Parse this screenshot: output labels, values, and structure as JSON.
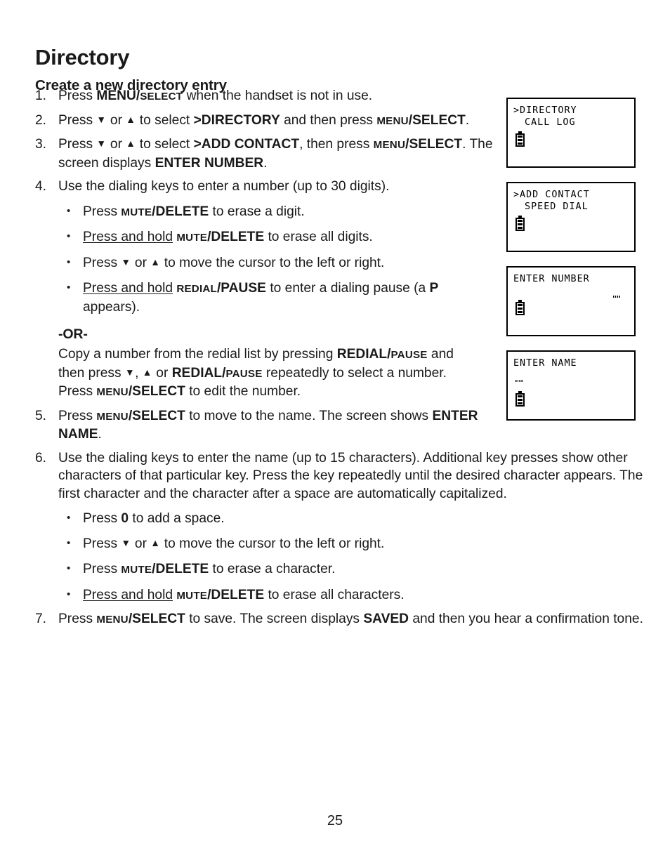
{
  "document": {
    "page_title": "Directory",
    "section_title": "Create a new directory entry",
    "page_number": "25"
  },
  "steps": [
    {
      "number": "1.",
      "parts": [
        {
          "t": "Press ",
          "s": "n"
        },
        {
          "t": "MENU",
          "s": "b"
        },
        {
          "t": "/",
          "s": "b"
        },
        {
          "t": "SELECT",
          "s": "sc"
        },
        {
          "t": " when the handset is not in use.",
          "s": "n"
        }
      ]
    },
    {
      "number": "2.",
      "parts": [
        {
          "t": "Press ",
          "s": "n"
        },
        {
          "t": "▼",
          "s": "ar"
        },
        {
          "t": " or ",
          "s": "n"
        },
        {
          "t": "▲",
          "s": "ar"
        },
        {
          "t": " to select ",
          "s": "n"
        },
        {
          "t": ">DIRECTORY",
          "s": "b"
        },
        {
          "t": " and then press ",
          "s": "n"
        },
        {
          "t": "MENU",
          "s": "sc"
        },
        {
          "t": "/SELECT",
          "s": "b"
        },
        {
          "t": ".",
          "s": "n"
        }
      ]
    },
    {
      "number": "3.",
      "parts": [
        {
          "t": "Press ",
          "s": "n"
        },
        {
          "t": "▼",
          "s": "ar"
        },
        {
          "t": " or ",
          "s": "n"
        },
        {
          "t": "▲",
          "s": "ar"
        },
        {
          "t": " to select ",
          "s": "n"
        },
        {
          "t": ">ADD CONTACT",
          "s": "b"
        },
        {
          "t": ", then press ",
          "s": "n"
        },
        {
          "t": "MENU",
          "s": "sc"
        },
        {
          "t": "/SELECT",
          "s": "b"
        },
        {
          "t": ". The screen displays ",
          "s": "n"
        },
        {
          "t": "ENTER NUMBER",
          "s": "b"
        },
        {
          "t": ".",
          "s": "n"
        }
      ]
    },
    {
      "number": "4.",
      "parts": [
        {
          "t": "Use the dialing keys to enter a number (up to 30 digits).",
          "s": "n"
        }
      ],
      "bullets": [
        [
          {
            "t": "Press ",
            "s": "n"
          },
          {
            "t": "MUTE",
            "s": "sc"
          },
          {
            "t": "/DELETE",
            "s": "b"
          },
          {
            "t": " to erase a digit.",
            "s": "n"
          }
        ],
        [
          {
            "t": "Press and hold",
            "s": "u"
          },
          {
            "t": " ",
            "s": "n"
          },
          {
            "t": "MUTE",
            "s": "sc"
          },
          {
            "t": "/DELETE",
            "s": "b"
          },
          {
            "t": " to erase all digits.",
            "s": "n"
          }
        ],
        [
          {
            "t": "Press ",
            "s": "n"
          },
          {
            "t": "▼",
            "s": "ar"
          },
          {
            "t": " or ",
            "s": "n"
          },
          {
            "t": "▲",
            "s": "ar"
          },
          {
            "t": " to move the cursor to the left or right.",
            "s": "n"
          }
        ],
        [
          {
            "t": "Press and hold",
            "s": "u"
          },
          {
            "t": " ",
            "s": "n"
          },
          {
            "t": "REDIAL",
            "s": "sc"
          },
          {
            "t": "/PAUSE",
            "s": "b"
          },
          {
            "t": " to enter a dialing pause (a ",
            "s": "n"
          },
          {
            "t": "P",
            "s": "b"
          },
          {
            "t": " appears).",
            "s": "n"
          }
        ]
      ],
      "or": {
        "label": "-OR-",
        "parts": [
          {
            "t": "Copy a number from the redial list by pressing ",
            "s": "n"
          },
          {
            "t": "REDIAL",
            "s": "b"
          },
          {
            "t": "/",
            "s": "b"
          },
          {
            "t": "PAUSE",
            "s": "sc"
          },
          {
            "t": " and then press ",
            "s": "n"
          },
          {
            "t": "▼",
            "s": "ar"
          },
          {
            "t": ", ",
            "s": "n"
          },
          {
            "t": "▲",
            "s": "ar"
          },
          {
            "t": " or ",
            "s": "n"
          },
          {
            "t": "REDIAL",
            "s": "b"
          },
          {
            "t": "/",
            "s": "b"
          },
          {
            "t": "PAUSE",
            "s": "sc"
          },
          {
            "t": " repeatedly to select a number. Press ",
            "s": "n"
          },
          {
            "t": "MENU",
            "s": "sc"
          },
          {
            "t": "/SELECT",
            "s": "b"
          },
          {
            "t": " to edit the number.",
            "s": "n"
          }
        ]
      }
    },
    {
      "number": "5.",
      "parts": [
        {
          "t": "Press ",
          "s": "n"
        },
        {
          "t": "MENU",
          "s": "sc"
        },
        {
          "t": "/SELECT",
          "s": "b"
        },
        {
          "t": " to move to the name. The screen shows ",
          "s": "n"
        },
        {
          "t": "ENTER NAME",
          "s": "b"
        },
        {
          "t": ".",
          "s": "n"
        }
      ]
    },
    {
      "number": "6.",
      "parts": [
        {
          "t": "Use the dialing keys to enter the name (up to 15 characters). Additional key presses show other characters of that particular key. Press the key repeatedly until the desired character appears. The first character and the character after a space are automatically capitalized.",
          "s": "n"
        }
      ],
      "bullets": [
        [
          {
            "t": "Press ",
            "s": "n"
          },
          {
            "t": "0",
            "s": "b"
          },
          {
            "t": " to add a space.",
            "s": "n"
          }
        ],
        [
          {
            "t": "Press ",
            "s": "n"
          },
          {
            "t": "▼",
            "s": "ar"
          },
          {
            "t": " or ",
            "s": "n"
          },
          {
            "t": "▲",
            "s": "ar"
          },
          {
            "t": " to move the cursor to the left or right.",
            "s": "n"
          }
        ],
        [
          {
            "t": "Press ",
            "s": "n"
          },
          {
            "t": "MUTE",
            "s": "sc"
          },
          {
            "t": "/DELETE",
            "s": "b"
          },
          {
            "t": " to erase a character.",
            "s": "n"
          }
        ],
        [
          {
            "t": "Press and hold",
            "s": "u"
          },
          {
            "t": " ",
            "s": "n"
          },
          {
            "t": "MUTE",
            "s": "sc"
          },
          {
            "t": "/DELETE",
            "s": "b"
          },
          {
            "t": " to erase all characters.",
            "s": "n"
          }
        ]
      ]
    },
    {
      "number": "7.",
      "parts": [
        {
          "t": "Press ",
          "s": "n"
        },
        {
          "t": "MENU",
          "s": "sc"
        },
        {
          "t": "/SELECT",
          "s": "b"
        },
        {
          "t": " to save. The screen displays ",
          "s": "n"
        },
        {
          "t": "SAVED",
          "s": "b"
        },
        {
          "t": " and then you hear a confirmation tone.",
          "s": "n"
        }
      ]
    }
  ],
  "lcd_screens": [
    {
      "name": "directory-menu-screen",
      "line1": ">DIRECTORY",
      "line2": " CALL LOG",
      "battery": true,
      "cursor": "none"
    },
    {
      "name": "add-contact-menu-screen",
      "line1": ">ADD CONTACT",
      "line2": " SPEED DIAL",
      "battery": true,
      "cursor": "none"
    },
    {
      "name": "enter-number-screen",
      "line1": "ENTER NUMBER",
      "line2": "",
      "battery": true,
      "cursor": "right"
    },
    {
      "name": "enter-name-screen",
      "line1": "ENTER NAME",
      "line2": "",
      "battery": true,
      "cursor": "left"
    }
  ],
  "icons": {
    "battery": "battery-icon",
    "cursor": "text-cursor-icon",
    "down_arrow": "down-arrow-icon",
    "up_arrow": "up-arrow-icon"
  },
  "colors": {
    "text": "#1a1a1a",
    "lcd_border": "#000000",
    "lcd_background": "#ffffff"
  }
}
